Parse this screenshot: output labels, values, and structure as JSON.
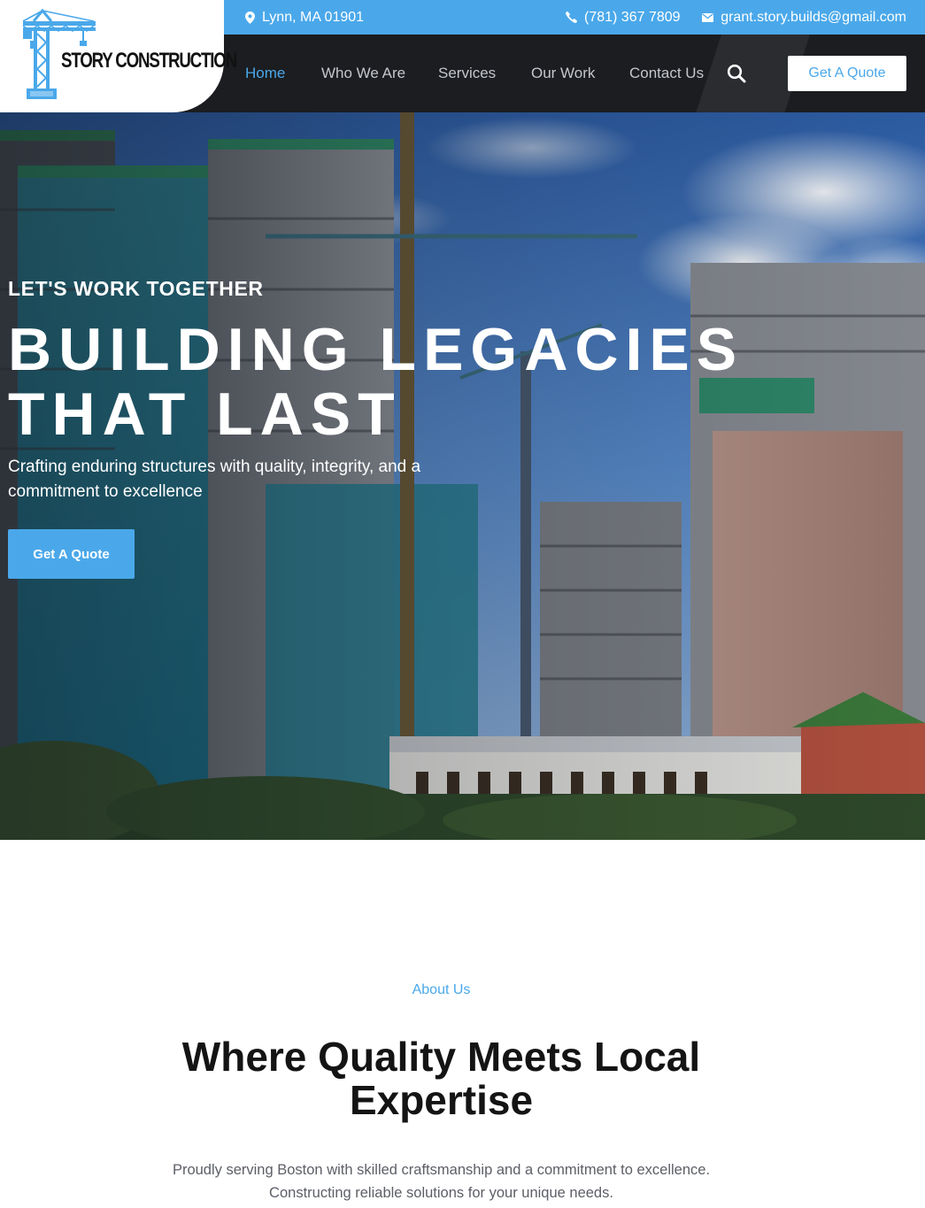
{
  "brand": {
    "name": "STORY CONSTRUCTION",
    "accent_color": "#4aa8ea",
    "dark_color": "#1b1d20",
    "logo_icon": "tower-crane-icon"
  },
  "topbar": {
    "location": "Lynn, MA 01901",
    "phone": "(781) 367 7809",
    "email": "grant.story.builds@gmail.com",
    "icons": [
      "map-pin-icon",
      "phone-icon",
      "mail-icon"
    ]
  },
  "nav": {
    "items": [
      {
        "label": "Home",
        "active": true
      },
      {
        "label": "Who We Are",
        "active": false
      },
      {
        "label": "Services",
        "active": false
      },
      {
        "label": "Our Work",
        "active": false
      },
      {
        "label": "Contact Us",
        "active": false
      }
    ],
    "search_icon": "search-icon",
    "cta_label": "Get A Quote"
  },
  "hero": {
    "kicker": "LET'S WORK TOGETHER",
    "title_line1": "BUILDING LEGACIES",
    "title_line2": "THAT LAST",
    "subtitle": "Crafting enduring structures with quality, integrity, and a commitment to excellence",
    "cta_label": "Get A Quote"
  },
  "about": {
    "kicker": "About Us",
    "title": "Where Quality Meets Local Expertise",
    "text": "Proudly serving Boston with skilled craftsmanship and a commitment to excellence. Constructing reliable solutions for your unique needs."
  }
}
